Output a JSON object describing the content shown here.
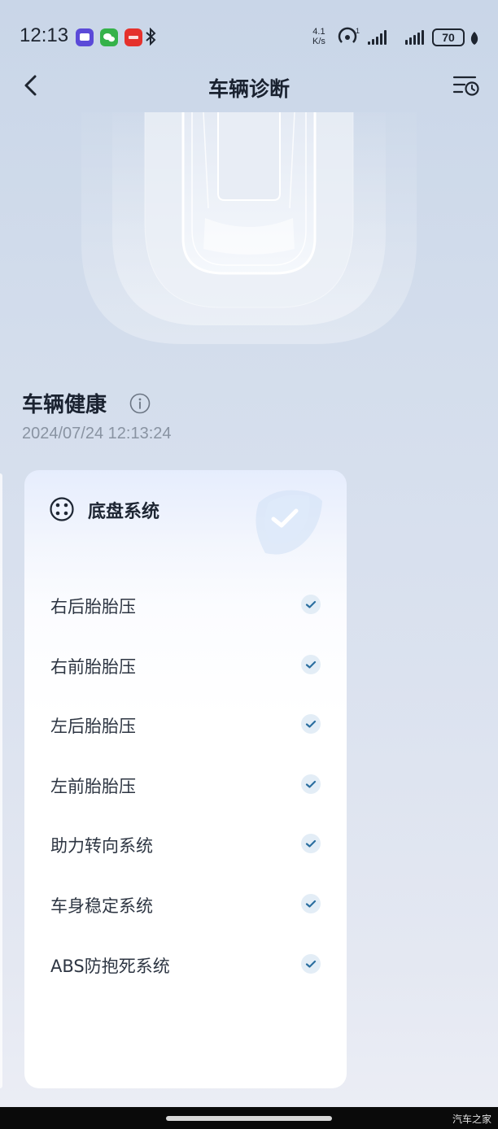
{
  "status": {
    "time": "12:13",
    "speed_value": "4.1",
    "speed_unit": "K/s",
    "battery": "70",
    "notification_icons": [
      "chat-icon",
      "wechat-icon",
      "news-icon",
      "bluetooth-icon"
    ]
  },
  "header": {
    "title": "车辆诊断",
    "back_icon": "chevron-left-icon",
    "history_icon": "list-history-icon"
  },
  "health": {
    "title": "车辆健康",
    "date": "2024/07/24 12:13:24"
  },
  "card": {
    "title": "底盘系统",
    "items": [
      {
        "label": "右后胎胎压",
        "status": "ok"
      },
      {
        "label": "右前胎胎压",
        "status": "ok"
      },
      {
        "label": "左后胎胎压",
        "status": "ok"
      },
      {
        "label": "左前胎胎压",
        "status": "ok"
      },
      {
        "label": "助力转向系统",
        "status": "ok"
      },
      {
        "label": "车身稳定系统",
        "status": "ok"
      },
      {
        "label": "ABS防抱死系统",
        "status": "ok"
      }
    ]
  },
  "watermark": "汽车之家",
  "colors": {
    "check": "#2c6fa0",
    "check_bg": "#e3edf6",
    "date_text": "#8993a2"
  }
}
